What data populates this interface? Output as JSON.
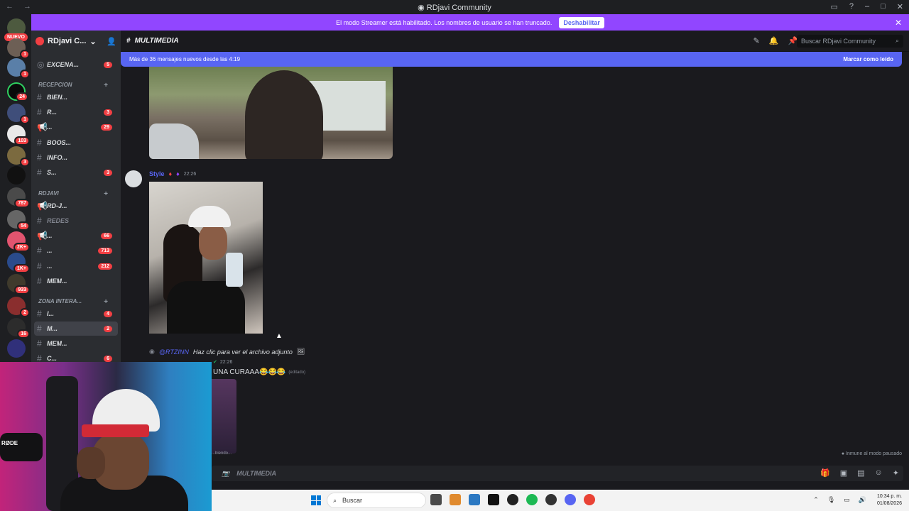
{
  "window": {
    "title": "RDjavi Community"
  },
  "streamer_banner": {
    "text": "El modo Streamer está habilitado. Los nombres de usuario se han truncado.",
    "button": "Deshabilitar"
  },
  "servers": {
    "nuevo": "NUEVO",
    "badges": [
      "1",
      "1",
      "24",
      "1",
      "103",
      "3",
      "787",
      "54",
      "2K+",
      "1K+",
      "933",
      "2",
      "16"
    ]
  },
  "guild": {
    "name": "RDjavi C..."
  },
  "channels": {
    "top": {
      "label": "EXCENA...",
      "badge": "5"
    },
    "categories": [
      {
        "label": "RECEPCION"
      },
      {
        "label": "RDJAVI"
      },
      {
        "label": "ZONA INTERA..."
      }
    ],
    "items": [
      {
        "label": "BIEN...",
        "badge": ""
      },
      {
        "label": "R...",
        "badge": "3"
      },
      {
        "label": "...",
        "badge": "29"
      },
      {
        "label": "BOOS...",
        "badge": ""
      },
      {
        "label": "INFO...",
        "badge": ""
      },
      {
        "label": "S...",
        "badge": "3"
      },
      {
        "label": "RD-J...",
        "badge": ""
      },
      {
        "label": "REDES",
        "badge": ""
      },
      {
        "label": "...",
        "badge": "66"
      },
      {
        "label": "...",
        "badge": "713"
      },
      {
        "label": "...",
        "badge": "212"
      },
      {
        "label": "MEM...",
        "badge": ""
      },
      {
        "label": "I...",
        "badge": "4"
      },
      {
        "label": "M...",
        "badge": "2"
      },
      {
        "label": "MEM...",
        "badge": ""
      },
      {
        "label": "C...",
        "badge": "6"
      }
    ]
  },
  "channel_header": {
    "name": "MULTIMEDIA",
    "search_placeholder": "Buscar RDjavi Community"
  },
  "new_messages": {
    "text": "Más de 36 mensajes nuevos desde las 4:19",
    "mark_read": "Marcar como leído"
  },
  "messages": {
    "first": {
      "user": "Style",
      "time": "22:26"
    },
    "reply": {
      "user": "@RTZINN",
      "text": "Haz clic para ver el archivo adjunto"
    },
    "second": {
      "time": "22:26",
      "text": "UNA CURAAA😂😂😂",
      "edited": "(editado)"
    },
    "typing": "...biendo...",
    "immune": "Inmune al modo pausado"
  },
  "composer": {
    "placeholder": "MULTIMEDIA"
  },
  "webcam": {
    "brand": "RØDE"
  },
  "taskbar": {
    "search": "Buscar",
    "time": "10:34 p. m.",
    "date": "01/08/2026"
  },
  "colors": {
    "accent": "#5865f2",
    "banner": "#9146ff",
    "badge": "#f23f43"
  }
}
